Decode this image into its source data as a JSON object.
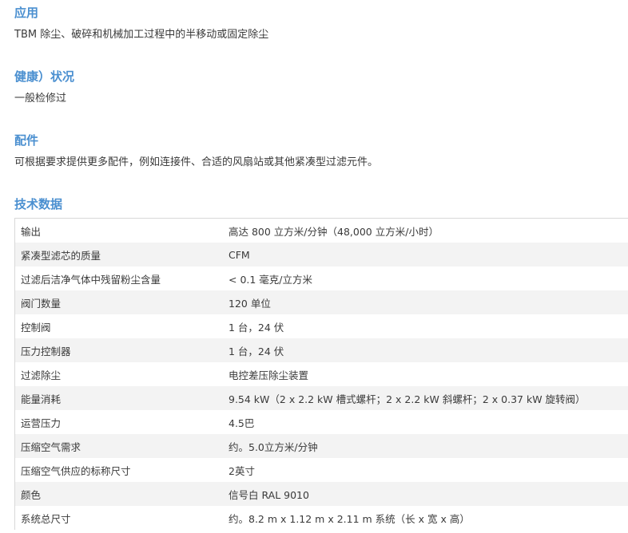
{
  "sections": {
    "application": {
      "heading": "应用",
      "text": "TBM 除尘、破碎和机械加工过程中的半移动或固定除尘"
    },
    "health": {
      "heading": "健康）状况",
      "text": "一般检修过"
    },
    "accessories": {
      "heading": "配件",
      "text": "可根据要求提供更多配件，例如连接件、合适的风扇站或其他紧凑型过滤元件。"
    },
    "technical": {
      "heading": "技术数据"
    }
  },
  "specs": [
    {
      "label": "输出",
      "value": "高达 800 立方米/分钟（48,000 立方米/小时）"
    },
    {
      "label": "紧凑型滤芯的质量",
      "value": "CFM"
    },
    {
      "label": "过滤后洁净气体中残留粉尘含量",
      "value": "< 0.1 毫克/立方米"
    },
    {
      "label": "阀门数量",
      "value": "120 单位"
    },
    {
      "label": "控制阀",
      "value": "1 台，24 伏"
    },
    {
      "label": "压力控制器",
      "value": "1 台，24 伏"
    },
    {
      "label": "过滤除尘",
      "value": "电控差压除尘装置"
    },
    {
      "label": "能量消耗",
      "value": "9.54 kW（2 x 2.2 kW 槽式螺杆；2 x 2.2 kW 斜螺杆；2 x 0.37 kW 旋转阀）"
    },
    {
      "label": "运营压力",
      "value": "4.5巴"
    },
    {
      "label": "压缩空气需求",
      "value": "约。5.0立方米/分钟"
    },
    {
      "label": "压缩空气供应的标称尺寸",
      "value": "2英寸"
    },
    {
      "label": "颜色",
      "value": "信号白 RAL 9010"
    },
    {
      "label": "系统总尺寸",
      "value": "约。8.2 m x 1.12 m x 2.11 m 系统（长 x 宽 x 高）"
    }
  ]
}
